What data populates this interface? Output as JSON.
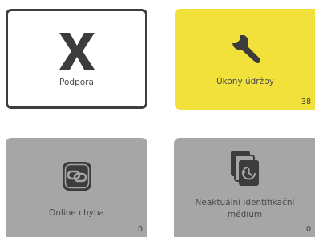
{
  "tiles": [
    {
      "label": "Podpora",
      "icon": "x-icon",
      "count": "",
      "background": "#ffffff",
      "border": "#3e3e3e"
    },
    {
      "label": "Úkony údržby",
      "icon": "wrench-icon",
      "count": "38",
      "background": "#f2e13a"
    },
    {
      "label": "Online chyba",
      "icon": "link-icon",
      "count": "0",
      "background": "#a6a6a6"
    },
    {
      "label": "Neaktuální identifikační médium",
      "icon": "id-media-timer-icon",
      "count": "0",
      "background": "#a6a6a6"
    }
  ],
  "colors": {
    "icon_dark": "#3c3c3c",
    "text": "#4a4a4a"
  }
}
